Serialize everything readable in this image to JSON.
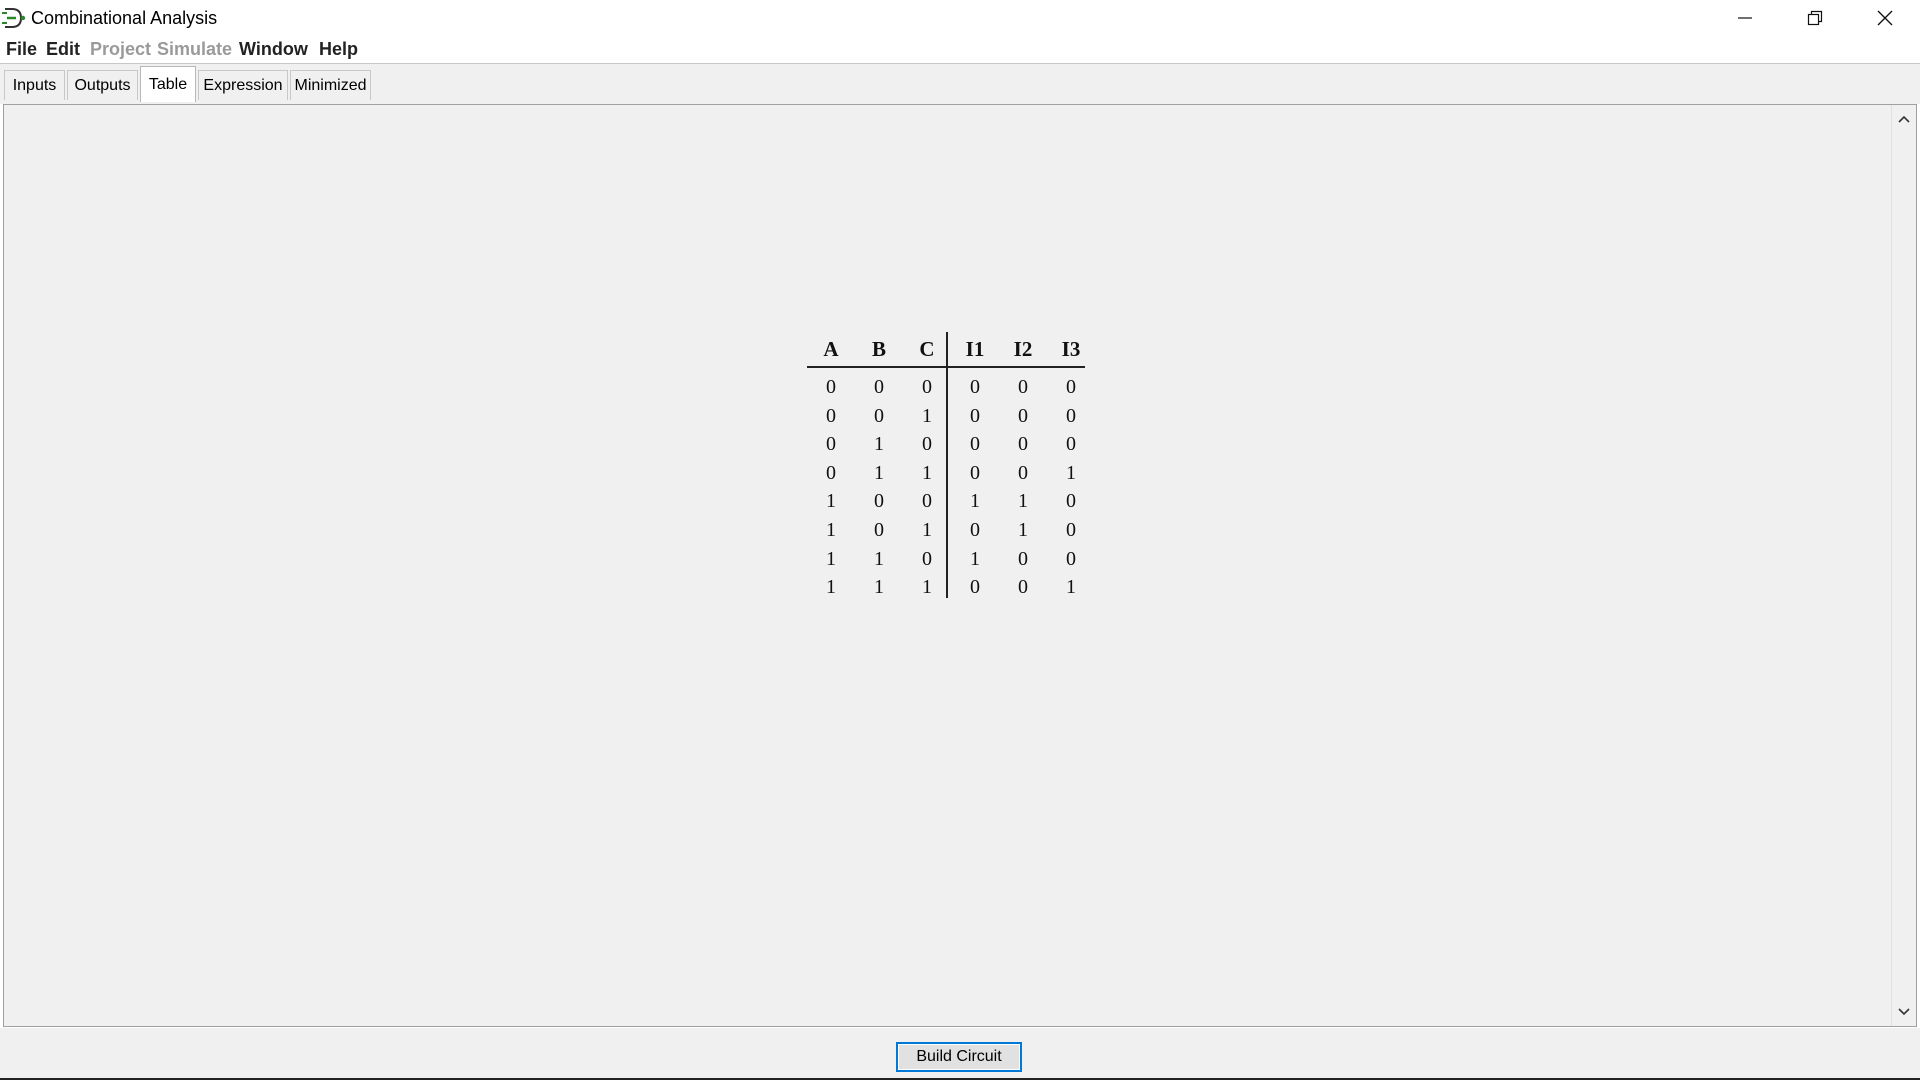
{
  "window": {
    "title": "Combinational Analysis",
    "controls": [
      "minimize",
      "restore",
      "close"
    ]
  },
  "menu": {
    "items": [
      {
        "label": "File",
        "enabled": true
      },
      {
        "label": "Edit",
        "enabled": true
      },
      {
        "label": "Project",
        "enabled": false
      },
      {
        "label": "Simulate",
        "enabled": false
      },
      {
        "label": "Window",
        "enabled": true
      },
      {
        "label": "Help",
        "enabled": true
      }
    ]
  },
  "tabs": {
    "items": [
      {
        "label": "Inputs"
      },
      {
        "label": "Outputs"
      },
      {
        "label": "Table"
      },
      {
        "label": "Expression"
      },
      {
        "label": "Minimized"
      }
    ],
    "active": "Table"
  },
  "table": {
    "inputs": [
      "A",
      "B",
      "C"
    ],
    "outputs": [
      "I1",
      "I2",
      "I3"
    ],
    "rows": [
      [
        "0",
        "0",
        "0",
        "0",
        "0",
        "0"
      ],
      [
        "0",
        "0",
        "1",
        "0",
        "0",
        "0"
      ],
      [
        "0",
        "1",
        "0",
        "0",
        "0",
        "0"
      ],
      [
        "0",
        "1",
        "1",
        "0",
        "0",
        "1"
      ],
      [
        "1",
        "0",
        "0",
        "1",
        "1",
        "0"
      ],
      [
        "1",
        "0",
        "1",
        "0",
        "1",
        "0"
      ],
      [
        "1",
        "1",
        "0",
        "1",
        "0",
        "0"
      ],
      [
        "1",
        "1",
        "1",
        "0",
        "0",
        "1"
      ]
    ]
  },
  "actions": {
    "build_label": "Build Circuit"
  },
  "colors": {
    "accent": "#0078d7",
    "panel_bg": "#f0f0f0",
    "disabled_text": "#9a9a9a"
  }
}
